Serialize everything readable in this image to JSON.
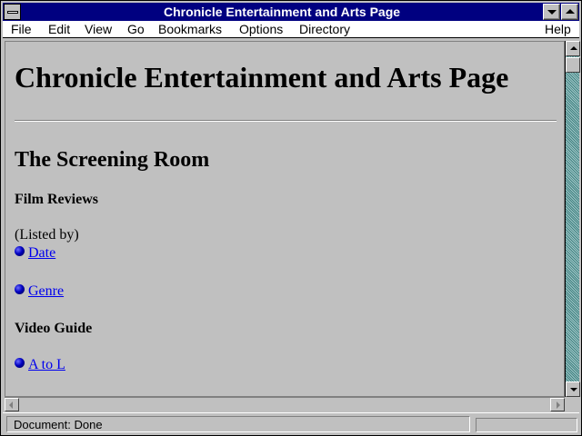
{
  "window": {
    "title": "Chronicle Entertainment and Arts Page"
  },
  "menu": {
    "items": [
      {
        "label": "File"
      },
      {
        "label": "Edit"
      },
      {
        "label": "View"
      },
      {
        "label": "Go"
      },
      {
        "label": "Bookmarks"
      },
      {
        "label": "Options"
      },
      {
        "label": "Directory"
      },
      {
        "label": "Help"
      }
    ]
  },
  "page": {
    "heading": "Chronicle Entertainment and Arts Page",
    "section_title": "The Screening Room",
    "film_reviews": {
      "heading": "Film Reviews",
      "note": "(Listed by)",
      "links": [
        "Date",
        "Genre"
      ]
    },
    "video_guide": {
      "heading": "Video Guide",
      "links": [
        "A to L"
      ]
    }
  },
  "status": {
    "text": "Document: Done"
  },
  "colors": {
    "titlebar": "#000080",
    "link": "#0000ee",
    "background": "#c0c0c0"
  }
}
